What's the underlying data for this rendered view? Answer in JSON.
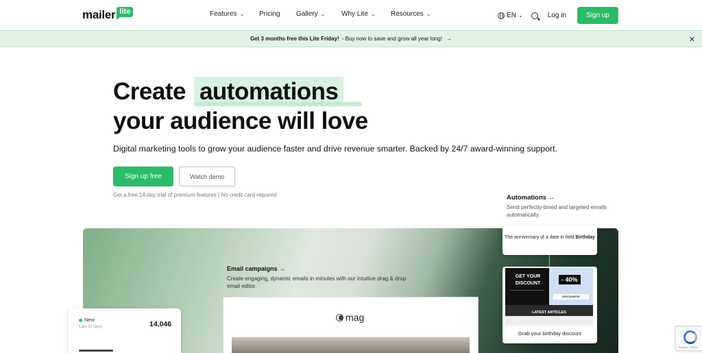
{
  "nav": {
    "logo_word": "mailer",
    "logo_badge": "lite",
    "links": [
      {
        "label": "Features",
        "has_dropdown": true
      },
      {
        "label": "Pricing",
        "has_dropdown": false
      },
      {
        "label": "Gallery",
        "has_dropdown": true
      },
      {
        "label": "Why Lite",
        "has_dropdown": true
      },
      {
        "label": "Resources",
        "has_dropdown": true
      }
    ],
    "language": "EN",
    "login": "Log in",
    "signup": "Sign up"
  },
  "banner": {
    "bold": "Get 3 months free this Lite Friday!",
    "text": "Buy now to save and grow all year long!",
    "arrow": "→",
    "close": "✕"
  },
  "hero": {
    "line1_prefix": "Create",
    "highlight": "automations",
    "line2": "your audience will love",
    "subtitle": "Digital marketing tools to grow your audience faster and drive revenue smarter. Backed by 24/7 award-winning support.",
    "cta_primary": "Sign up free",
    "cta_secondary": "Watch demo",
    "trial_note": "Get a free 14-day trial of premium features | No credit card required"
  },
  "automations": {
    "title": "Automations →",
    "description": "Send perfectly-timed and targeted emails automatically.",
    "node_text": "The anniversary of a date in field",
    "node_field": "Birthday",
    "email": {
      "headline": "GET YOUR DISCOUNT",
      "percent": "- 40%",
      "code": "DISCOUNT50",
      "latest": "LATEST ARTICLES"
    },
    "caption": "Grab your birthday discount"
  },
  "email_campaigns": {
    "title": "Email campaigns →",
    "description": "Create engaging, dynamic emails in minutes with our intuitive drag & drop email editor.",
    "brand": "mag"
  },
  "stats": {
    "label": "New",
    "period": "Last 30 days",
    "value": "14,046"
  },
  "colors": {
    "brand_green": "#2cbb6a",
    "banner_bg": "#dff3e6",
    "highlight_bg": "#d6f2e0"
  }
}
